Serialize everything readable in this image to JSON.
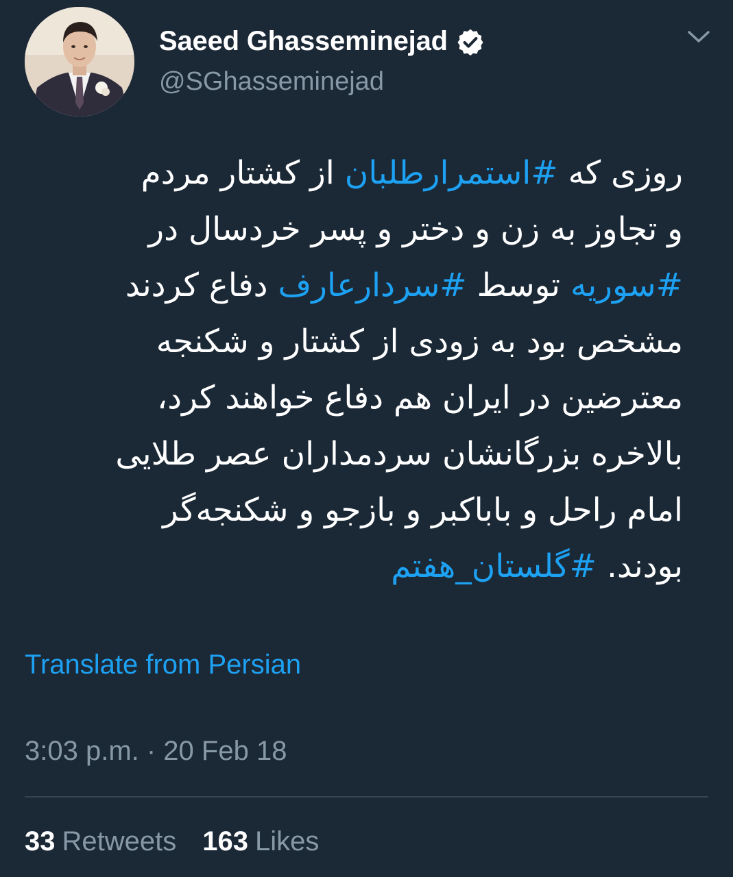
{
  "colors": {
    "background": "#1b2836",
    "text_primary": "#ffffff",
    "text_secondary": "#8899a6",
    "link": "#1da1f2",
    "divider": "#38444d"
  },
  "author": {
    "display_name": "Saeed Ghasseminejad",
    "handle": "@SGhasseminejad",
    "verified": true,
    "avatar_icon": "profile-photo",
    "verified_icon": "verified-badge-icon",
    "menu_icon": "chevron-down-icon"
  },
  "tweet": {
    "lines": [
      [
        {
          "text": "روزی که ",
          "hashtag": false
        },
        {
          "text": "#استمرارطلبان",
          "hashtag": true
        },
        {
          "text": " از کشتار مردم",
          "hashtag": false
        }
      ],
      [
        {
          "text": "و تجاوز به زن و دختر و پسر خردسال در",
          "hashtag": false
        }
      ],
      [
        {
          "text": "#سوریه",
          "hashtag": true
        },
        {
          "text": " توسط ",
          "hashtag": false
        },
        {
          "text": "#سردارعارف",
          "hashtag": true
        },
        {
          "text": " دفاع کردند",
          "hashtag": false
        }
      ],
      [
        {
          "text": "مشخص بود به زودی از کشتار و شکنجه",
          "hashtag": false
        }
      ],
      [
        {
          "text": "معترضین در ایران هم دفاع خواهند کرد،",
          "hashtag": false
        }
      ],
      [
        {
          "text": "بالاخره بزرگانشان سردمداران عصر طلایی",
          "hashtag": false
        }
      ],
      [
        {
          "text": "امام راحل و باباکبر و بازجو و شکنجه‌گر",
          "hashtag": false
        }
      ],
      [
        {
          "text": "بودند. ",
          "hashtag": false
        },
        {
          "text": "#گلستان_هفتم",
          "hashtag": true
        }
      ]
    ],
    "translate_label": "Translate from Persian",
    "timestamp": "3:03 p.m. · 20 Feb 18"
  },
  "stats": {
    "retweets_count": "33",
    "retweets_label": "Retweets",
    "likes_count": "163",
    "likes_label": "Likes"
  }
}
